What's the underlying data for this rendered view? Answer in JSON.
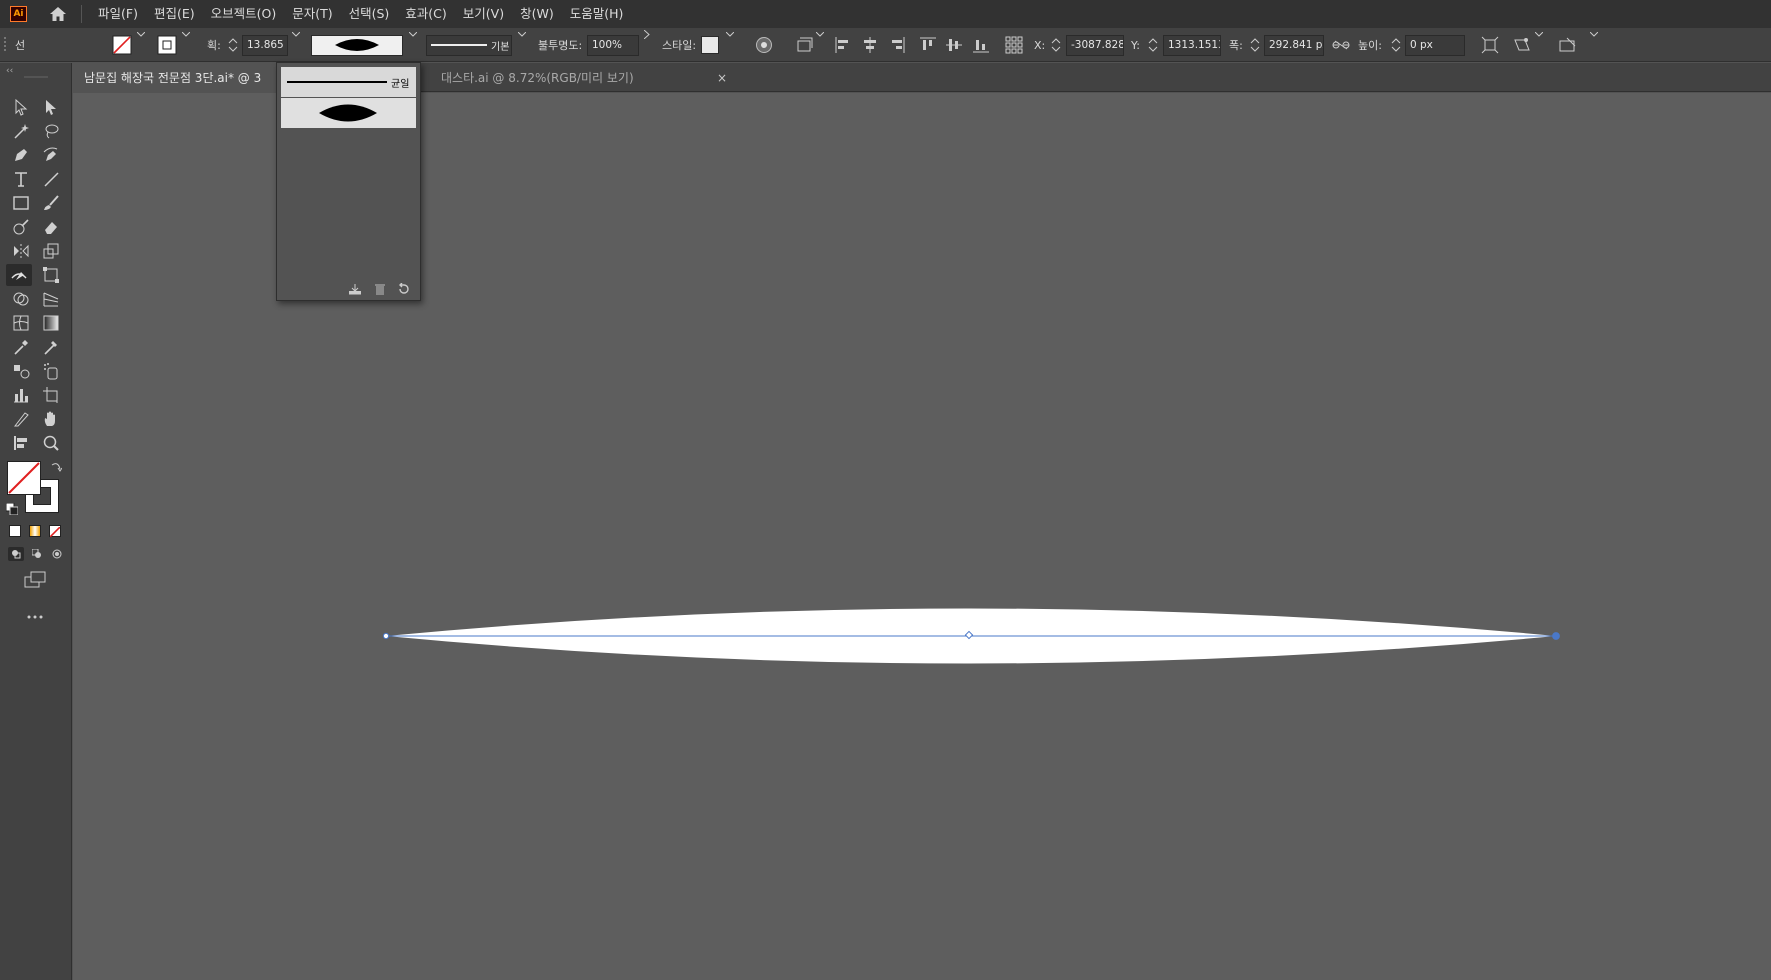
{
  "app": {
    "logo_text": "Ai",
    "accent": "#ff9a00"
  },
  "menu": {
    "items": [
      "파일(F)",
      "편집(E)",
      "오브젝트(O)",
      "문자(T)",
      "선택(S)",
      "효과(C)",
      "보기(V)",
      "창(W)",
      "도움말(H)"
    ]
  },
  "control_bar": {
    "selection_label": "선",
    "stroke_label": "획:",
    "stroke_weight": "13.865 p",
    "brush_label": "기본",
    "opacity_label": "불투명도:",
    "opacity_value": "100%",
    "style_label": "스타일:",
    "x_label": "X:",
    "x_value": "-3087.8286",
    "y_label": "Y:",
    "y_value": "1313.1513",
    "width_label": "폭:",
    "width_value": "292.841 px",
    "height_label": "높이:",
    "height_value": "0 px"
  },
  "tabs": [
    {
      "label": "남문집 해장국 전문점 3단.ai* @ 3"
    },
    {
      "label": "대스타.ai @ 8.72%(RGB/미리 보기)",
      "close": "×"
    }
  ],
  "profile_panel": {
    "row1_label": "균일"
  },
  "colors": {
    "canvas": "#5e5e5e",
    "panel": "#424242",
    "menubar": "#323232",
    "path_blue": "#4a78c8",
    "shape_fill": "#ffffff"
  }
}
